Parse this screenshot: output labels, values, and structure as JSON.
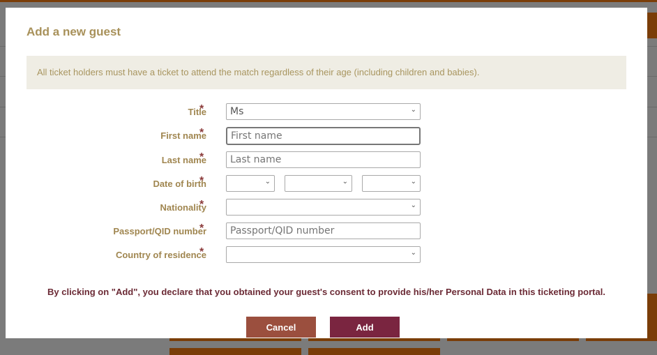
{
  "modal": {
    "title": "Add a new guest",
    "notice": "All ticket holders must have a ticket to attend the match regardless of their age (including children and babies).",
    "required_mark": "*",
    "fields": [
      {
        "label": "Title",
        "type": "select",
        "value": "Ms"
      },
      {
        "label": "First name",
        "type": "text",
        "placeholder": "First name"
      },
      {
        "label": "Last name",
        "type": "text",
        "placeholder": "Last name"
      },
      {
        "label": "Date of birth",
        "type": "date-selects",
        "day": "",
        "month": "",
        "year": ""
      },
      {
        "label": "Nationality",
        "type": "select",
        "value": ""
      },
      {
        "label": "Passport/QID number",
        "type": "text",
        "placeholder": "Passport/QID number"
      },
      {
        "label": "Country of residence",
        "type": "select",
        "value": ""
      }
    ],
    "consent": "By clicking on \"Add\", you declare that you obtained your guest's consent to provide his/her Personal Data in this ticketing portal.",
    "cancel_label": "Cancel",
    "add_label": "Add"
  },
  "colors": {
    "title": "#a8915a",
    "label": "#a08650",
    "required": "#8b3a3a",
    "consent": "#6b2a35",
    "cancel": "#9b4f3e",
    "add": "#7a2540",
    "overlay": "#7b7b7b",
    "accent": "#7a3d08"
  }
}
